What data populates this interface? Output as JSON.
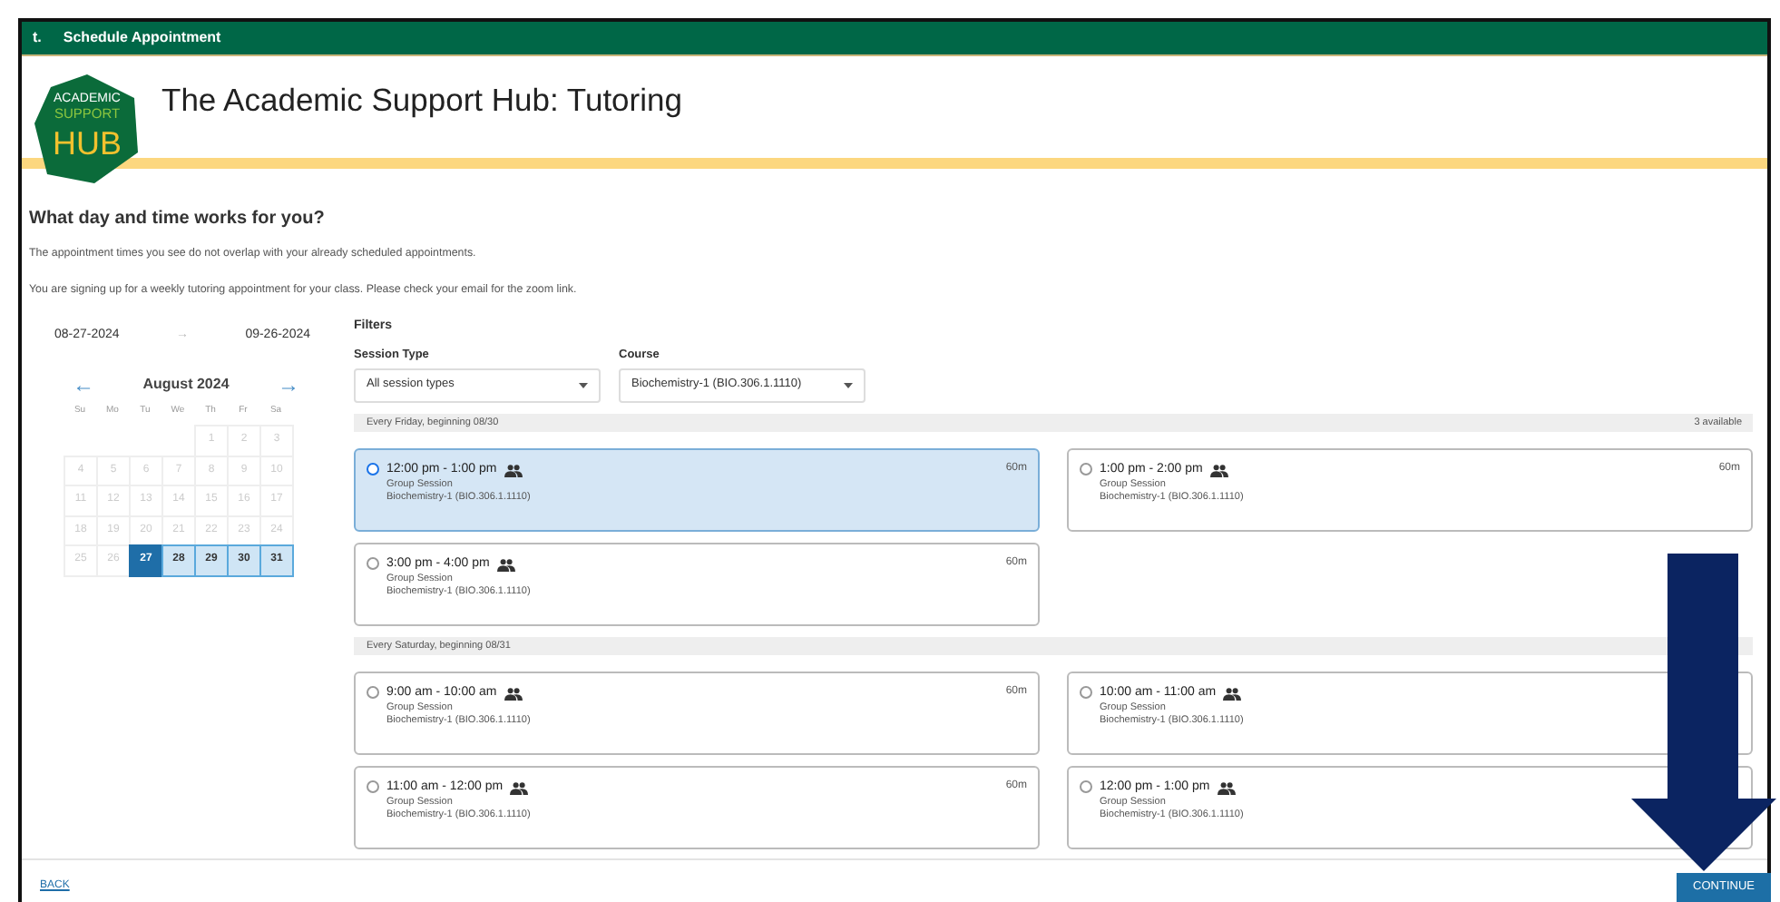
{
  "window": {
    "app_mark": "t.",
    "title": "Schedule Appointment"
  },
  "logo": {
    "lines": [
      "ACADEMIC",
      "SUPPORT",
      "HUB"
    ]
  },
  "page_title": "The Academic Support Hub: Tutoring",
  "heading": "What day and time works for you?",
  "notes": [
    "The appointment times you see do not overlap with your already scheduled appointments.",
    "You are signing up for a weekly tutoring appointment for your class. Please check your email for the zoom link."
  ],
  "date_range": {
    "start": "08-27-2024",
    "arrow": "→",
    "end": "09-26-2024"
  },
  "calendar": {
    "prev": "←",
    "month": "August 2024",
    "next": "→",
    "weekdays": [
      "Su",
      "Mo",
      "Tu",
      "We",
      "Th",
      "Fr",
      "Sa"
    ],
    "weeks": [
      [
        {
          "day": "1",
          "disabled": true,
          "selected": false
        },
        {
          "day": "2",
          "disabled": true,
          "selected": false
        },
        {
          "day": "3",
          "disabled": true,
          "selected": false
        }
      ],
      [
        {
          "day": "4",
          "disabled": true,
          "selected": false
        },
        {
          "day": "5",
          "disabled": true,
          "selected": false
        },
        {
          "day": "6",
          "disabled": true,
          "selected": false
        },
        {
          "day": "7",
          "disabled": true,
          "selected": false
        },
        {
          "day": "8",
          "disabled": true,
          "selected": false
        },
        {
          "day": "9",
          "disabled": true,
          "selected": false
        },
        {
          "day": "10",
          "disabled": true,
          "selected": false
        }
      ],
      [
        {
          "day": "11",
          "disabled": true,
          "selected": false
        },
        {
          "day": "12",
          "disabled": true,
          "selected": false
        },
        {
          "day": "13",
          "disabled": true,
          "selected": false
        },
        {
          "day": "14",
          "disabled": true,
          "selected": false
        },
        {
          "day": "15",
          "disabled": true,
          "selected": false
        },
        {
          "day": "16",
          "disabled": true,
          "selected": false
        },
        {
          "day": "17",
          "disabled": true,
          "selected": false
        }
      ],
      [
        {
          "day": "18",
          "disabled": true,
          "selected": false
        },
        {
          "day": "19",
          "disabled": true,
          "selected": false
        },
        {
          "day": "20",
          "disabled": true,
          "selected": false
        },
        {
          "day": "21",
          "disabled": true,
          "selected": false
        },
        {
          "day": "22",
          "disabled": true,
          "selected": false
        },
        {
          "day": "23",
          "disabled": true,
          "selected": false
        },
        {
          "day": "24",
          "disabled": true,
          "selected": false
        }
      ],
      [
        {
          "day": "25",
          "disabled": true,
          "selected": false
        },
        {
          "day": "26",
          "disabled": true,
          "selected": false
        },
        {
          "day": "27",
          "disabled": false,
          "selected": true
        },
        {
          "day": "28",
          "disabled": false,
          "selected": false
        },
        {
          "day": "29",
          "disabled": false,
          "selected": false
        },
        {
          "day": "30",
          "disabled": false,
          "selected": false
        },
        {
          "day": "31",
          "disabled": false,
          "selected": false
        }
      ]
    ]
  },
  "filters": {
    "title": "Filters",
    "fields": [
      {
        "label": "Session Type",
        "value": "All session types"
      },
      {
        "label": "Course",
        "value": "Biochemistry-1 (BIO.306.1.1110)"
      }
    ]
  },
  "groups": [
    {
      "heading": "Every Friday, beginning 08/30",
      "available": "3 available",
      "slots": [
        {
          "time": "12:00 pm - 1:00 pm",
          "type": "Group Session",
          "course": "Biochemistry-1 (BIO.306.1.1110)",
          "duration": "60m",
          "selected": true
        },
        {
          "time": "1:00 pm - 2:00 pm",
          "type": "Group Session",
          "course": "Biochemistry-1 (BIO.306.1.1110)",
          "duration": "60m",
          "selected": false
        },
        {
          "time": "3:00 pm - 4:00 pm",
          "type": "Group Session",
          "course": "Biochemistry-1 (BIO.306.1.1110)",
          "duration": "60m",
          "selected": false
        }
      ]
    },
    {
      "heading": "Every Saturday, beginning 08/31",
      "slots": [
        {
          "time": "9:00 am - 10:00 am",
          "type": "Group Session",
          "course": "Biochemistry-1 (BIO.306.1.1110)",
          "duration": "60m",
          "selected": false
        },
        {
          "time": "10:00 am - 11:00 am",
          "type": "Group Session",
          "course": "Biochemistry-1 (BIO.306.1.1110)",
          "selected": false
        },
        {
          "time": "11:00 am - 12:00 pm",
          "type": "Group Session",
          "course": "Biochemistry-1 (BIO.306.1.1110)",
          "duration": "60m",
          "selected": false
        },
        {
          "time": "12:00 pm - 1:00 pm",
          "type": "Group Session",
          "course": "Biochemistry-1 (BIO.306.1.1110)",
          "selected": false
        }
      ]
    }
  ],
  "footer": {
    "back": "BACK",
    "continue": "CONTINUE"
  }
}
